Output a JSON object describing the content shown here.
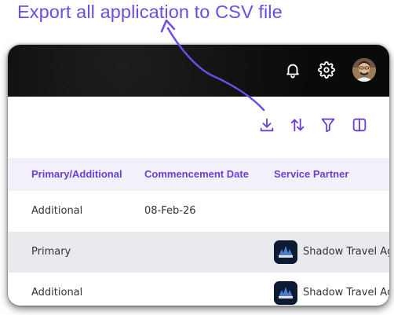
{
  "annotation": {
    "text": "Export all application to CSV file",
    "color": "#6c4ce4"
  },
  "topbar": {
    "icons": [
      "bell-icon",
      "gear-icon"
    ],
    "avatar": "user-avatar"
  },
  "toolbar": {
    "icons": [
      "download-icon",
      "sort-icon",
      "filter-icon",
      "columns-icon"
    ],
    "accent": "#6a3fd6"
  },
  "table": {
    "headers": {
      "type": "Primary/Additional",
      "commencement": "Commencement Date",
      "partner": "Service Partner"
    },
    "rows": [
      {
        "type": "Additional",
        "commencement": "08-Feb-26",
        "partner": ""
      },
      {
        "type": "Primary",
        "commencement": "",
        "partner": "Shadow Travel Ag"
      },
      {
        "type": "Additional",
        "commencement": "",
        "partner": "Shadow Travel Ag"
      }
    ]
  }
}
